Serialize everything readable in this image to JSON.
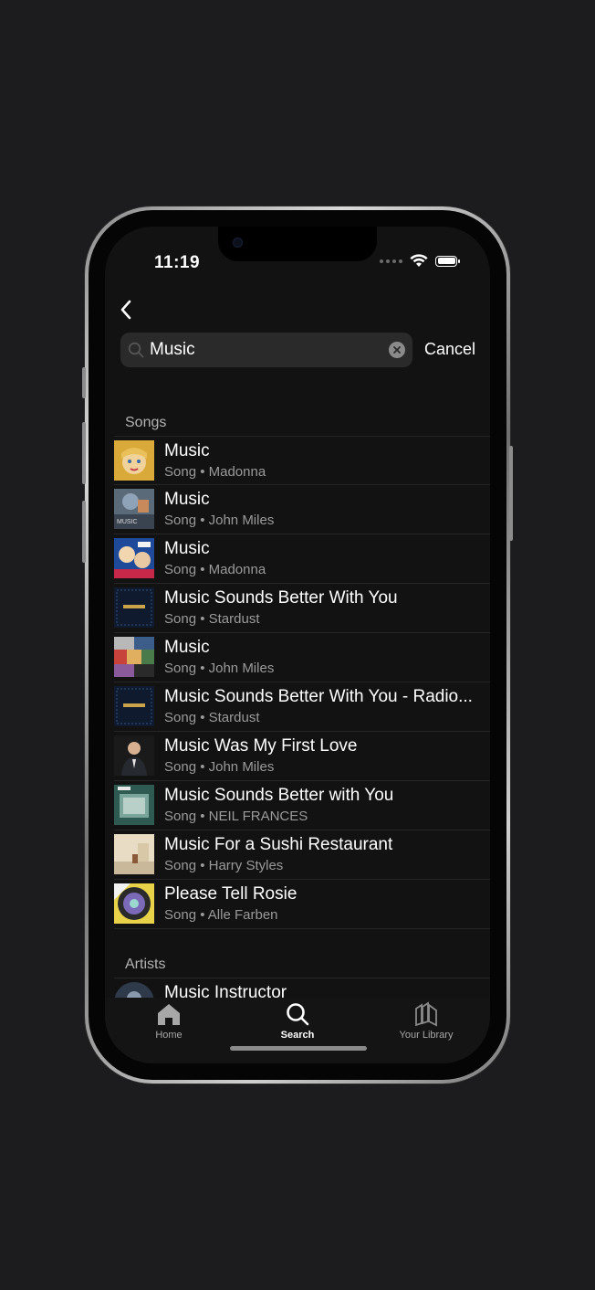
{
  "status_bar": {
    "time": "11:19"
  },
  "search": {
    "query": "Music",
    "placeholder": "",
    "cancel_label": "Cancel"
  },
  "sections": {
    "songs_title": "Songs",
    "artists_title": "Artists"
  },
  "songs": [
    {
      "title": "Music",
      "subtitle": "Song • Madonna",
      "art": "madonna-music-cover"
    },
    {
      "title": "Music",
      "subtitle": "Song • John Miles",
      "art": "john-miles-music-cover"
    },
    {
      "title": "Music",
      "subtitle": "Song • Madonna",
      "art": "madonna-live-cover"
    },
    {
      "title": "Music Sounds Better With You",
      "subtitle": "Song • Stardust",
      "art": "stardust-cover"
    },
    {
      "title": "Music",
      "subtitle": "Song • John Miles",
      "art": "john-miles-collage-cover"
    },
    {
      "title": "Music Sounds Better With You - Radio...",
      "subtitle": "Song • Stardust",
      "art": "stardust-cover"
    },
    {
      "title": "Music Was My First Love",
      "subtitle": "Song • John Miles",
      "art": "john-miles-portrait-cover"
    },
    {
      "title": "Music Sounds Better with You",
      "subtitle": "Song • NEIL FRANCES",
      "art": "neil-frances-cover"
    },
    {
      "title": "Music For a Sushi Restaurant",
      "subtitle": "Song • Harry Styles",
      "art": "harrys-house-cover"
    },
    {
      "title": "Please Tell Rosie",
      "subtitle": "Song • Alle Farben",
      "art": "alle-farben-cover"
    }
  ],
  "artists": [
    {
      "title": "Music Instructor",
      "art": "music-instructor-avatar"
    }
  ],
  "tabbar": {
    "home_label": "Home",
    "search_label": "Search",
    "library_label": "Your Library"
  },
  "colors": {
    "background": "#1c1c1e",
    "screen": "#121212",
    "text_primary": "#ffffff",
    "text_secondary": "#9a9a9a",
    "search_field": "#2a2a2a"
  },
  "icons": [
    "back-chevron-icon",
    "search-icon",
    "clear-icon",
    "home-icon",
    "library-icon",
    "wifi-icon",
    "battery-icon"
  ]
}
